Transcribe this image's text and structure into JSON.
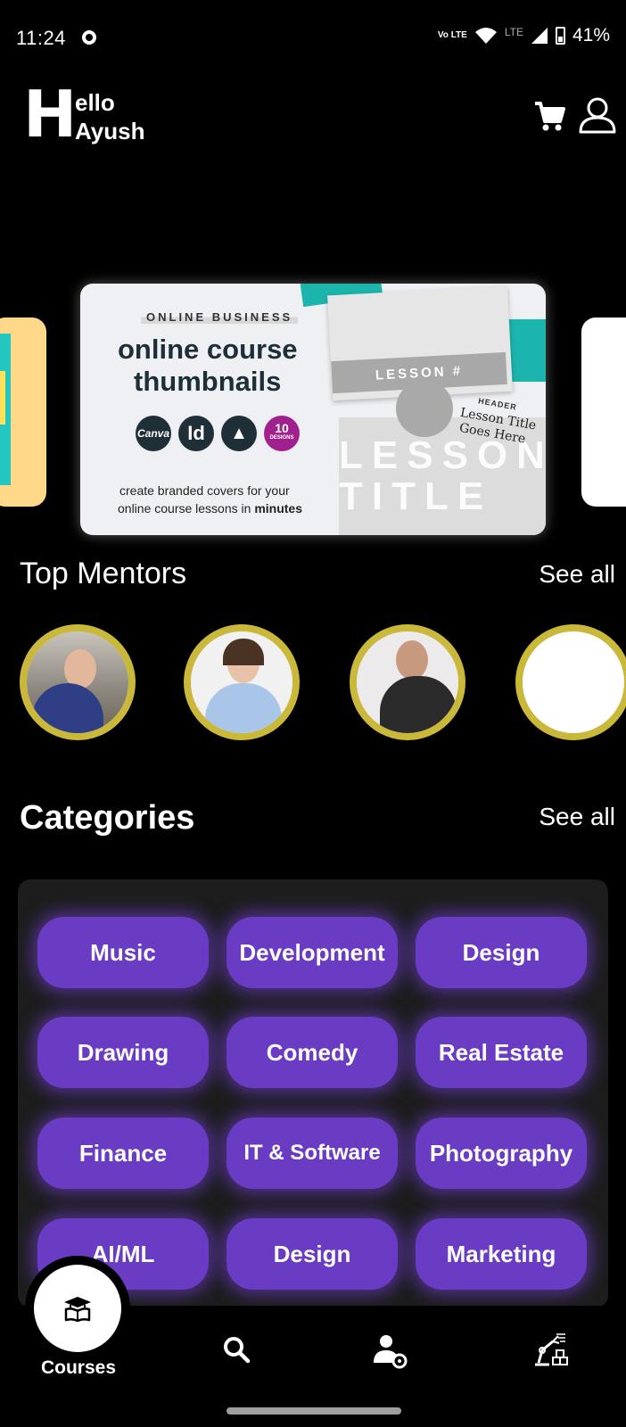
{
  "status_bar": {
    "time": "11:24",
    "volte": "Vo LTE",
    "lte": "LTE",
    "battery_percent": "41%"
  },
  "header": {
    "greeting_initial": "H",
    "greeting_rest": "ello",
    "user_name": "Ayush",
    "cart_icon": "cart-icon",
    "profile_icon": "profile-icon"
  },
  "carousel": {
    "banner": {
      "tag": "ONLINE BUSINESS",
      "title_line1": "online course",
      "title_line2": "thumbnails",
      "badges": [
        "Canva",
        "Id",
        "▲"
      ],
      "designs_badge_number": "10",
      "designs_badge_label": "DESIGNS",
      "lesson_bar": "LESSON #",
      "mock_header": "HEADER",
      "mock_lesson_title_line1": "Lesson Title",
      "mock_lesson_title_line2": "Goes Here",
      "mock_big_text": "LESSON TITLE",
      "caption_line1": "create branded covers for your",
      "caption_line2_start": "online course lessons in ",
      "caption_line2_bold": "minutes"
    }
  },
  "mentors": {
    "title": "Top Mentors",
    "see_all": "See all",
    "items": [
      {
        "name": "mentor-1"
      },
      {
        "name": "mentor-2"
      },
      {
        "name": "mentor-3"
      },
      {
        "name": "mentor-4"
      }
    ]
  },
  "categories": {
    "title": "Categories",
    "see_all": "See all",
    "items": [
      "Music",
      "Development",
      "Design",
      "Drawing",
      "Comedy",
      "Real Estate",
      "Finance",
      "IT & Software",
      "Photography",
      "AI/ML",
      "Design",
      "Marketing"
    ],
    "chip_color": "#6a3cc4"
  },
  "bottom_nav": {
    "courses_label": "Courses",
    "items": [
      "courses-icon",
      "search-icon",
      "mentor-settings-icon",
      "robot-arm-icon"
    ]
  },
  "colors": {
    "background": "#000000",
    "mentor_ring": "#c9b83a",
    "panel": "#1d1d1d"
  }
}
